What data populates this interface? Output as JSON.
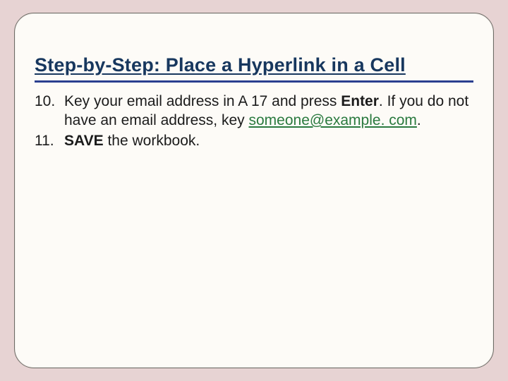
{
  "title": "Step-by-Step: Place a Hyperlink in a Cell",
  "steps": {
    "s10": {
      "num": "10.",
      "pre": "Key your email address in A 17 and press ",
      "bold1": "Enter",
      "mid": ". If you do not have an email address, key ",
      "link": "someone@example. com",
      "post": "."
    },
    "s11": {
      "num": "11.",
      "bold1": "SAVE ",
      "post": "the workbook."
    }
  }
}
